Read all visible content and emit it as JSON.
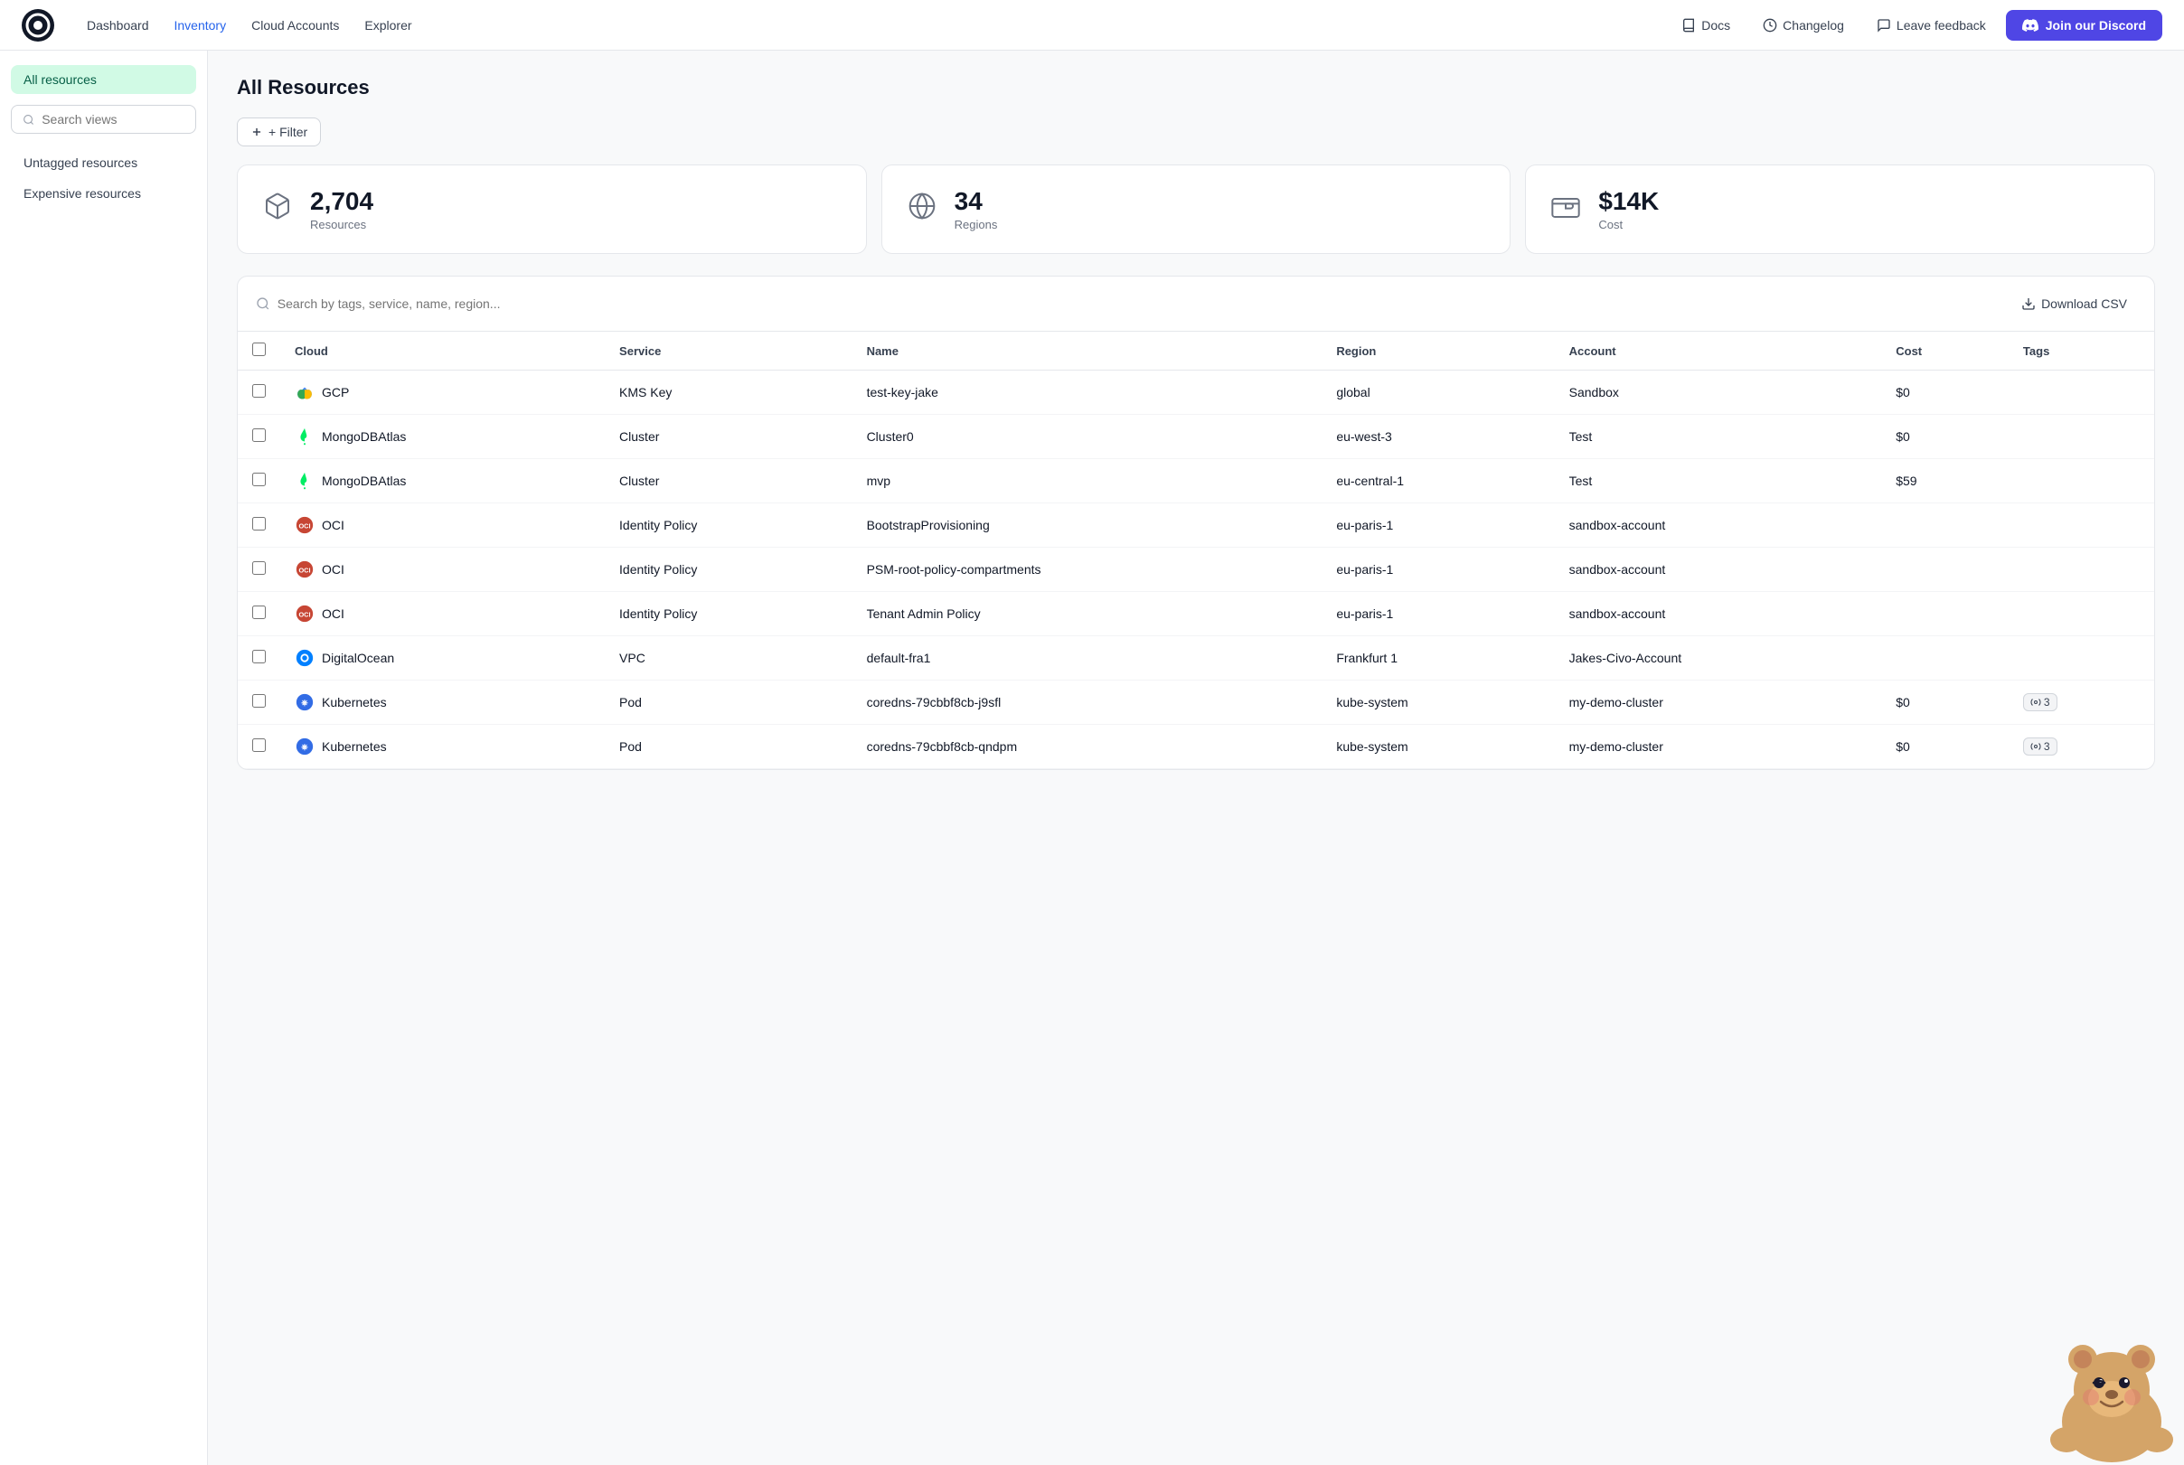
{
  "navbar": {
    "logo_alt": "Infracost Logo",
    "nav_items": [
      {
        "label": "Dashboard",
        "active": false
      },
      {
        "label": "Inventory",
        "active": true
      },
      {
        "label": "Cloud Accounts",
        "active": false
      },
      {
        "label": "Explorer",
        "active": false
      }
    ],
    "docs_label": "Docs",
    "changelog_label": "Changelog",
    "feedback_label": "Leave feedback",
    "discord_label": "Join our Discord"
  },
  "sidebar": {
    "all_resources_label": "All resources",
    "search_placeholder": "Search views",
    "nav_items": [
      {
        "label": "Untagged resources"
      },
      {
        "label": "Expensive resources"
      }
    ]
  },
  "page": {
    "title": "All Resources"
  },
  "filter": {
    "label": "+ Filter"
  },
  "stats": [
    {
      "icon": "cube",
      "value": "2,704",
      "label": "Resources"
    },
    {
      "icon": "globe",
      "value": "34",
      "label": "Regions"
    },
    {
      "icon": "wallet",
      "value": "$14K",
      "label": "Cost"
    }
  ],
  "table": {
    "search_placeholder": "Search by tags, service, name, region...",
    "download_csv_label": "Download CSV",
    "columns": [
      "Cloud",
      "Service",
      "Name",
      "Region",
      "Account",
      "Cost",
      "Tags"
    ],
    "rows": [
      {
        "cloud": "GCP",
        "service": "KMS Key",
        "name": "test-key-jake",
        "region": "global",
        "account": "Sandbox",
        "cost": "$0",
        "tags": ""
      },
      {
        "cloud": "MongoDBAtlas",
        "service": "Cluster",
        "name": "Cluster0",
        "region": "eu-west-3",
        "account": "Test",
        "cost": "$0",
        "tags": ""
      },
      {
        "cloud": "MongoDBAtlas",
        "service": "Cluster",
        "name": "mvp",
        "region": "eu-central-1",
        "account": "Test",
        "cost": "$59",
        "tags": ""
      },
      {
        "cloud": "OCI",
        "service": "Identity Policy",
        "name": "BootstrapProvisioning",
        "region": "eu-paris-1",
        "account": "sandbox-account",
        "cost": "",
        "tags": ""
      },
      {
        "cloud": "OCI",
        "service": "Identity Policy",
        "name": "PSM-root-policy-compartments",
        "region": "eu-paris-1",
        "account": "sandbox-account",
        "cost": "",
        "tags": ""
      },
      {
        "cloud": "OCI",
        "service": "Identity Policy",
        "name": "Tenant Admin Policy",
        "region": "eu-paris-1",
        "account": "sandbox-account",
        "cost": "",
        "tags": ""
      },
      {
        "cloud": "DigitalOcean",
        "service": "VPC",
        "name": "default-fra1",
        "region": "Frankfurt 1",
        "account": "Jakes-Civo-Account",
        "cost": "",
        "tags": ""
      },
      {
        "cloud": "Kubernetes",
        "service": "Pod",
        "name": "coredns-79cbbf8cb-j9sfl",
        "region": "kube-system",
        "account": "my-demo-cluster",
        "cost": "$0",
        "tags": "3"
      },
      {
        "cloud": "Kubernetes",
        "service": "Pod",
        "name": "coredns-79cbbf8cb-qndpm",
        "region": "kube-system",
        "account": "my-demo-cluster",
        "cost": "$0",
        "tags": "3"
      }
    ]
  }
}
